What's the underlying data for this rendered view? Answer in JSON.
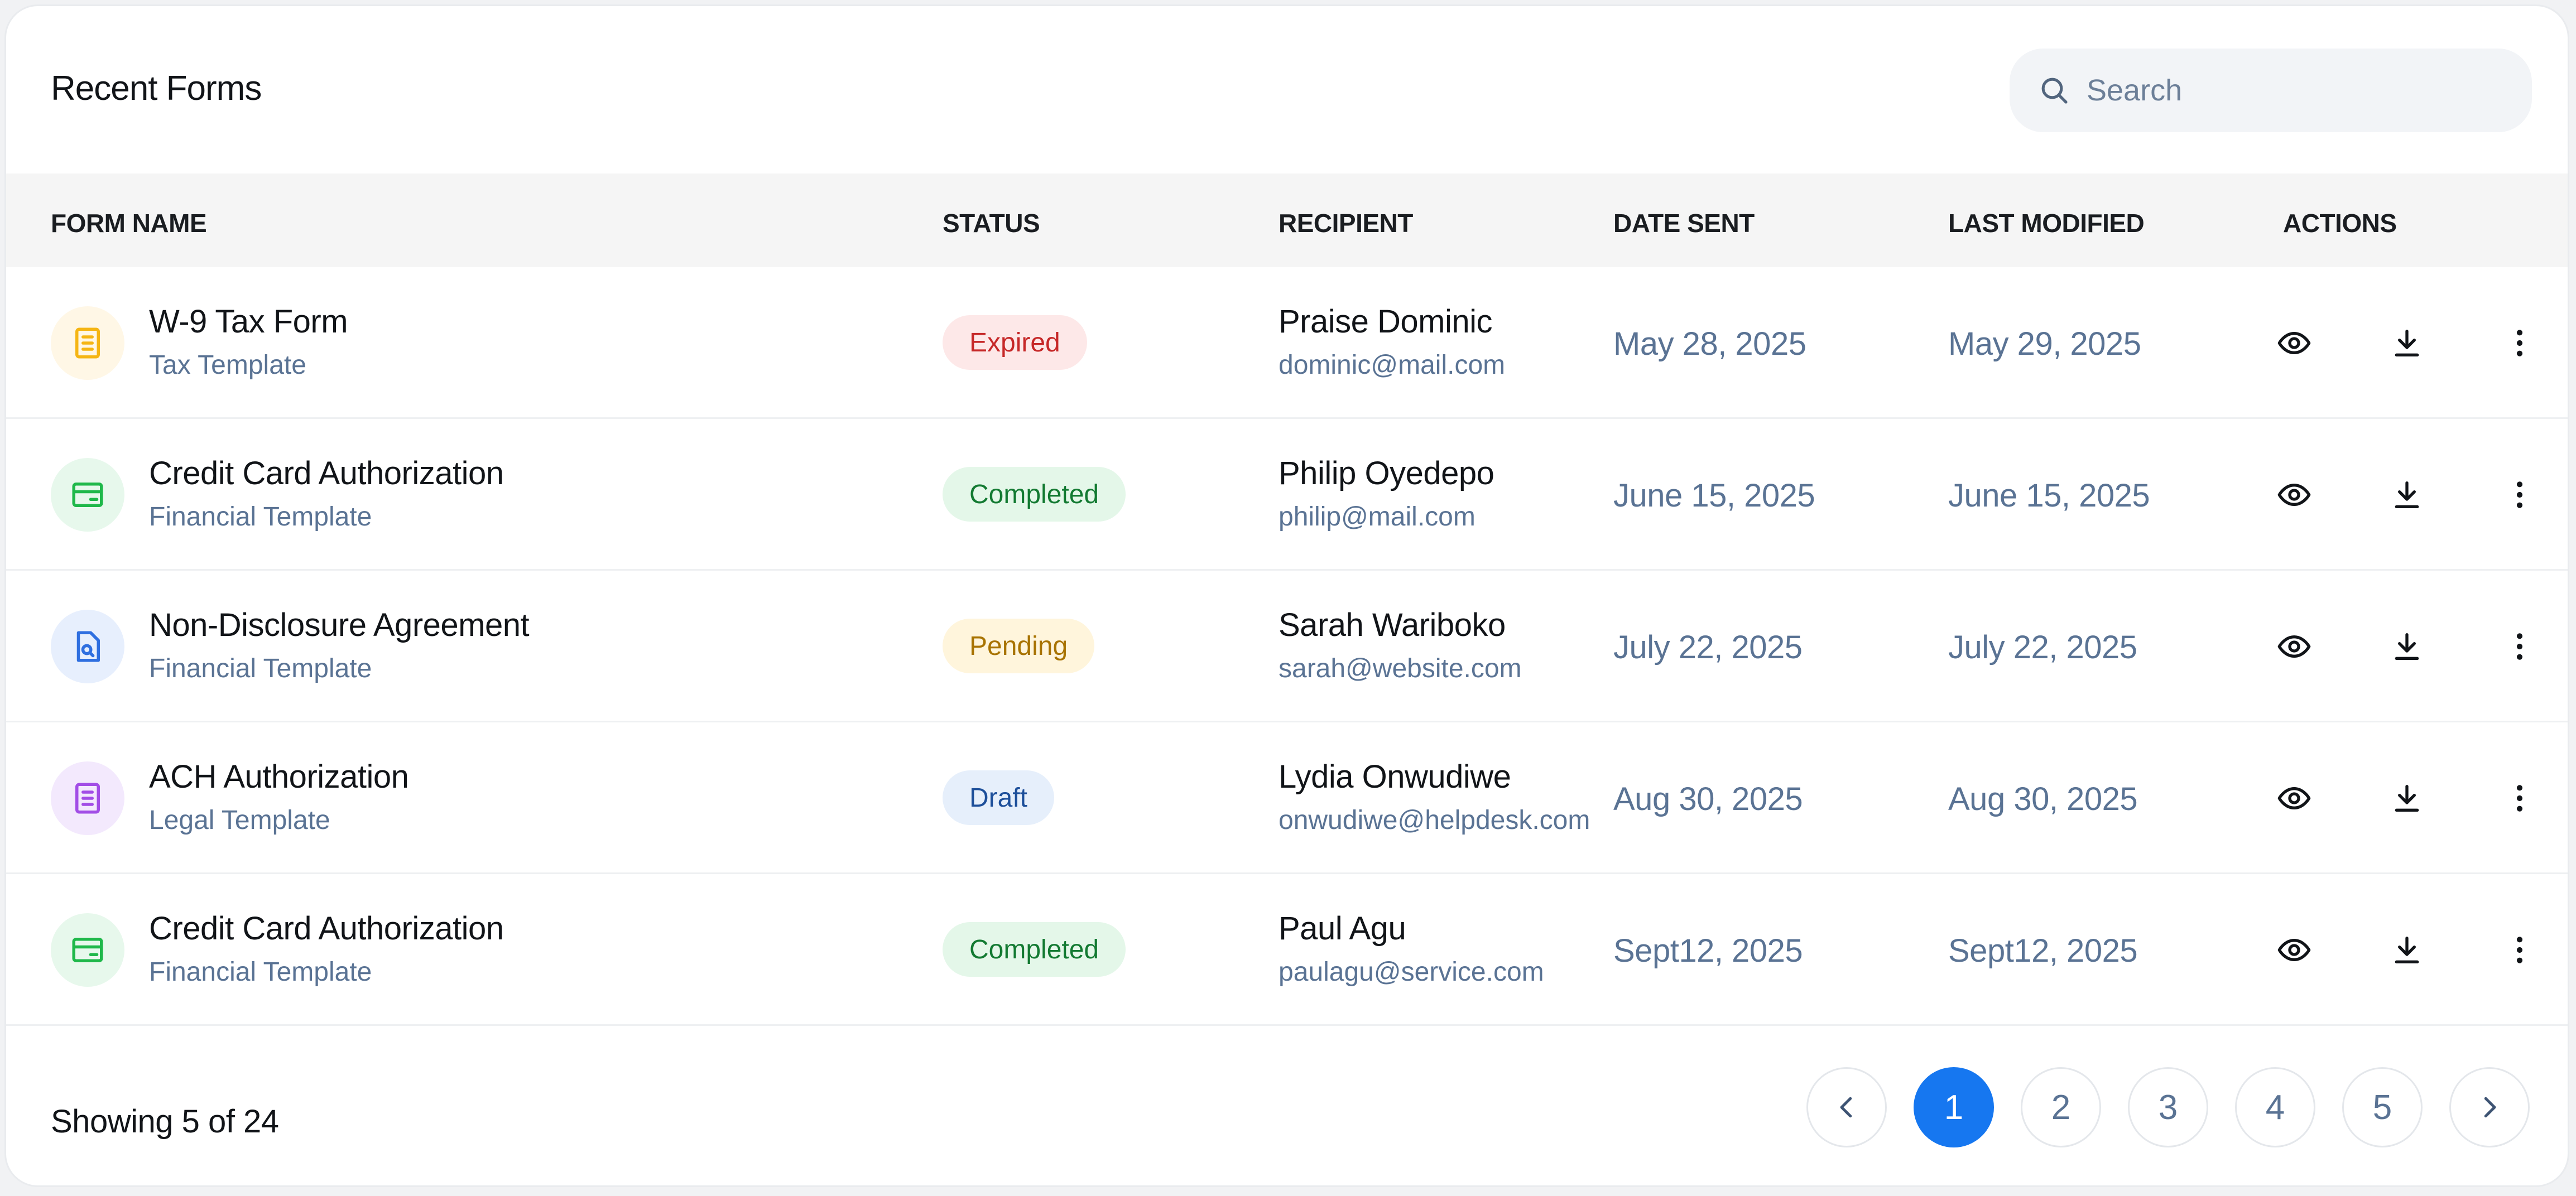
{
  "header": {
    "title": "Recent Forms",
    "search": {
      "placeholder": "Search",
      "value": ""
    }
  },
  "columns": [
    "FORM NAME",
    "STATUS",
    "RECIPIENT",
    "DATE SENT",
    "LAST MODIFIED",
    "ACTIONS"
  ],
  "rows": [
    {
      "form_name": "W-9 Tax Form",
      "template": "Tax Template",
      "icon": "document-lines-icon",
      "icon_color": "#f5b514",
      "icon_bg": "#fff7e6",
      "status": "Expired",
      "status_color": "#c62828",
      "status_bg": "#fde8e8",
      "recipient_name": "Praise Dominic",
      "recipient_email": "dominic@mail.com",
      "date_sent": "May 28, 2025",
      "last_modified": "May 29, 2025"
    },
    {
      "form_name": "Credit Card Authorization",
      "template": "Financial Template",
      "icon": "credit-card-icon",
      "icon_color": "#1fb84a",
      "icon_bg": "#e7f8ec",
      "status": "Completed",
      "status_color": "#137a32",
      "status_bg": "#e4f7e9",
      "recipient_name": "Philip Oyedepo",
      "recipient_email": "philip@mail.com",
      "date_sent": "June 15, 2025",
      "last_modified": "June 15, 2025"
    },
    {
      "form_name": "Non-Disclosure Agreement",
      "template": "Financial Template",
      "icon": "document-search-icon",
      "icon_color": "#2f6fe0",
      "icon_bg": "#e7effd",
      "status": "Pending",
      "status_color": "#a87300",
      "status_bg": "#fff5dc",
      "recipient_name": "Sarah Wariboko",
      "recipient_email": "sarah@website.com",
      "date_sent": "July 22, 2025",
      "last_modified": "July 22, 2025"
    },
    {
      "form_name": "ACH Authorization",
      "template": "Legal Template",
      "icon": "document-lines-icon",
      "icon_color": "#a24de6",
      "icon_bg": "#f3e9fd",
      "status": "Draft",
      "status_color": "#1d4f9a",
      "status_bg": "#e6effb",
      "recipient_name": "Lydia Onwudiwe",
      "recipient_email": "onwudiwe@helpdesk.com",
      "date_sent": "Aug 30, 2025",
      "last_modified": "Aug 30, 2025"
    },
    {
      "form_name": "Credit Card Authorization",
      "template": "Financial Template",
      "icon": "credit-card-icon",
      "icon_color": "#1fb84a",
      "icon_bg": "#e7f8ec",
      "status": "Completed",
      "status_color": "#137a32",
      "status_bg": "#e4f7e9",
      "recipient_name": "Paul Agu",
      "recipient_email": "paulagu@service.com",
      "date_sent": "Sept12, 2025",
      "last_modified": "Sept12, 2025"
    }
  ],
  "actions": [
    "eye-icon",
    "download-icon",
    "more-vertical-icon"
  ],
  "footer": {
    "showing": "Showing 5 of 24",
    "pages": [
      "1",
      "2",
      "3",
      "4",
      "5"
    ],
    "current_page": "1"
  },
  "colors": {
    "accent": "#1677f0",
    "muted_text": "#5a7394"
  }
}
